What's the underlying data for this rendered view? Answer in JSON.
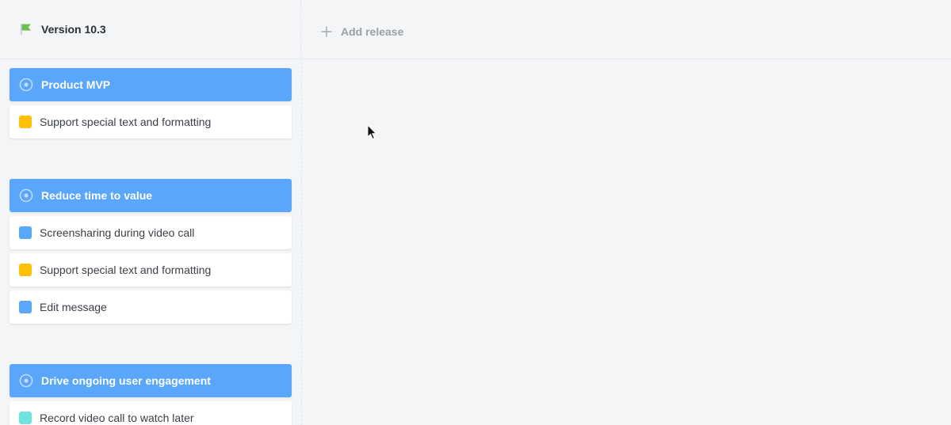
{
  "release": {
    "version_label": "Version 10.3",
    "flag_color": "#6ac14b",
    "add_release_label": "Add release"
  },
  "colors": {
    "group_header": "#5aa6fb",
    "yellow": "#ffc107",
    "blue": "#5aa6fb",
    "cyan": "#6ee3e0"
  },
  "groups": [
    {
      "title": "Product MVP",
      "items": [
        {
          "label": "Support special text and formatting",
          "color": "#ffc107"
        }
      ]
    },
    {
      "title": "Reduce time to value",
      "items": [
        {
          "label": "Screensharing during video call",
          "color": "#5aa6fb"
        },
        {
          "label": "Support special text and formatting",
          "color": "#ffc107"
        },
        {
          "label": "Edit message",
          "color": "#5aa6fb"
        }
      ]
    },
    {
      "title": "Drive ongoing user engagement",
      "items": [
        {
          "label": "Record video call to watch later",
          "color": "#6ee3e0"
        }
      ]
    }
  ]
}
